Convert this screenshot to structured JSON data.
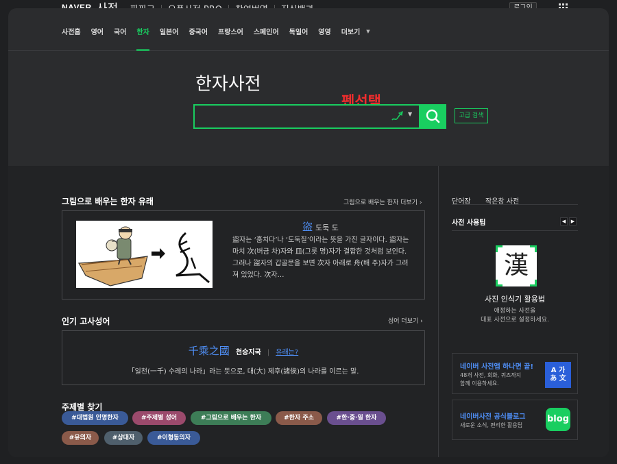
{
  "header": {
    "brand": "NAVER",
    "brand_dict": "사전",
    "nav": [
      "파파고",
      "오픈사전 PRO",
      "참여번역",
      "지식백과"
    ],
    "login": "로그인"
  },
  "tabs": [
    "사전홈",
    "영어",
    "국어",
    "한자",
    "일본어",
    "중국어",
    "프랑스어",
    "스페인어",
    "독일어",
    "영영",
    "더보기"
  ],
  "active_tab": "한자",
  "hero": {
    "title": "한자사전",
    "annotation": "펜선택",
    "search_value": "",
    "advanced_search": "고급 검색"
  },
  "origin": {
    "title": "그림으로 배우는 한자 유래",
    "more": "그림으로 배우는 한자 더보기",
    "hanja": "盜",
    "reading": "도둑 도",
    "body": "盜자는 ‘훔치다’나 ‘도둑질’이라는 뜻을 가진 글자이다. 盜자는 마치 次(버금 차)자와 皿(그릇 명)자가 결합한 것처럼 보인다. 그러나 盜자의 갑골문을 보면 次자 아래로 舟(배 주)자가  그려져 있었다. 次자…"
  },
  "idiom": {
    "title": "인기 고사성어",
    "more": "성어 더보기",
    "hanja": "千乘之國",
    "reading": "천승지국",
    "link": "유래는?",
    "desc": "「일천(一千) 수레의 나라」라는 뜻으로, 대(大) 제후(諸侯)의 나라를 이르는 말."
  },
  "topics": {
    "title": "주제별 찾기",
    "tags": [
      {
        "label": "#대법원 인명한자",
        "color": "#3a5a97"
      },
      {
        "label": "#주제별 성어",
        "color": "#9b4a6c"
      },
      {
        "label": "#그림으로 배우는 한자",
        "color": "#3d7d57"
      },
      {
        "label": "#한자 주소",
        "color": "#8a5a4a"
      },
      {
        "label": "#한·중·일 한자",
        "color": "#6a4f8f"
      },
      {
        "label": "#유의자",
        "color": "#8a5a4a"
      },
      {
        "label": "#상대자",
        "color": "#4f5f6c"
      },
      {
        "label": "#이형동의자",
        "color": "#3a5a97"
      }
    ]
  },
  "sidebar": {
    "tabs": [
      "단어장",
      "작은창 사전"
    ],
    "tip_heading": "사전 사용팁",
    "logo_char": "漢",
    "tip_title": "사진 인식기 활용법",
    "tip_desc_1": "애정하는 사전을",
    "tip_desc_2": "대표 사전으로 설정하세요.",
    "app_title": "네이버 사전앱 하나면 끝!",
    "app_desc_1": "48개 사전, 회화, 퀴즈까지",
    "app_desc_2": "함께 이용하세요.",
    "app_icon_1": "A 가",
    "app_icon_2": "あ 文",
    "blog_title": "네이버사전 공식블로그",
    "blog_desc": "새로운 소식, 편리한 활용팁",
    "blog_icon": "blog"
  },
  "colors": {
    "accent": "#19ce60",
    "link": "#4f8ff7",
    "annotation": "#f12d2d"
  }
}
